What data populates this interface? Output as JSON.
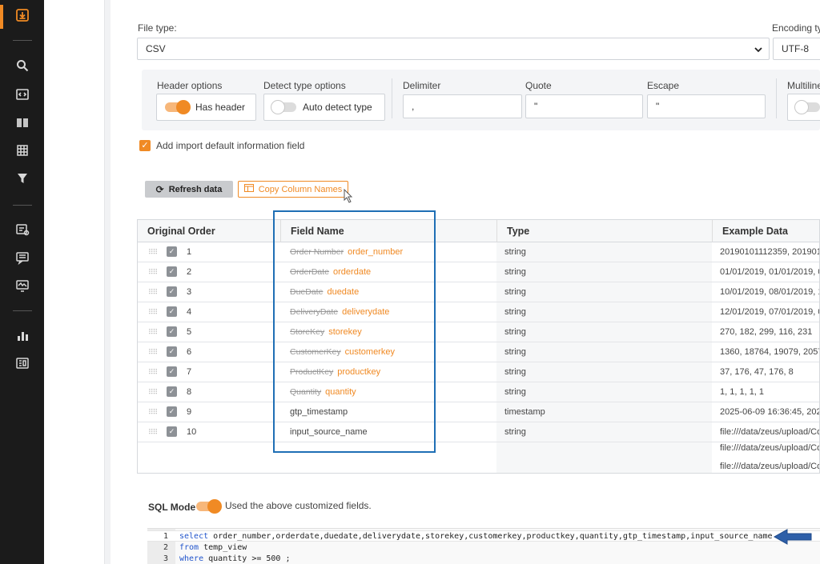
{
  "colors": {
    "accent": "#f08a24",
    "highlight": "#1f6fb5",
    "nav_bg": "#1b1b1b"
  },
  "nav": {
    "icons": [
      "import-icon",
      "search-icon",
      "code-icon",
      "book-icon",
      "table-icon",
      "funnel-icon",
      "workflow-icon",
      "message-icon",
      "monitor-icon",
      "bar-chart-icon",
      "report-icon"
    ]
  },
  "form": {
    "file_type_label": "File type:",
    "file_type_value": "CSV",
    "encoding_label": "Encoding ty",
    "encoding_value": "UTF-8"
  },
  "options": {
    "header_label": "Header options",
    "header_toggle": "Has header",
    "detect_label": "Detect type options",
    "detect_toggle": "Auto detect type",
    "delimiter_label": "Delimiter",
    "delimiter_value": ",",
    "quote_label": "Quote",
    "quote_value": "\"",
    "escape_label": "Escape",
    "escape_value": "\"",
    "multiline_label": "Multiline"
  },
  "import_default_label": "Add import default information field",
  "buttons": {
    "refresh": "Refresh data",
    "copy_columns": "Copy Column Names"
  },
  "table": {
    "headers": [
      "Original Order",
      "Field Name",
      "Type",
      "Example Data"
    ],
    "rows": [
      {
        "n": "1",
        "old": "Order Number",
        "name": "order_number",
        "type": "string",
        "example": "20190101112359, 201901"
      },
      {
        "n": "2",
        "old": "OrderDate",
        "name": "orderdate",
        "type": "string",
        "example": "01/01/2019, 01/01/2019, 0"
      },
      {
        "n": "3",
        "old": "DueDate",
        "name": "duedate",
        "type": "string",
        "example": "10/01/2019, 08/01/2019, 1"
      },
      {
        "n": "4",
        "old": "DeliveryDate",
        "name": "deliverydate",
        "type": "string",
        "example": "12/01/2019, 07/01/2019, 0"
      },
      {
        "n": "5",
        "old": "StoreKey",
        "name": "storekey",
        "type": "string",
        "example": "270, 182, 299, 116, 231"
      },
      {
        "n": "6",
        "old": "CustomerKey",
        "name": "customerkey",
        "type": "string",
        "example": "1360, 18764, 19079, 2057,"
      },
      {
        "n": "7",
        "old": "ProductKey",
        "name": "productkey",
        "type": "string",
        "example": "37, 176, 47, 176, 8"
      },
      {
        "n": "8",
        "old": "Quantity",
        "name": "quantity",
        "type": "string",
        "example": "1, 1, 1, 1, 1"
      },
      {
        "n": "9",
        "old": "",
        "name": "gtp_timestamp",
        "type": "timestamp",
        "example": "2025-06-09 16:36:45, 2025-"
      },
      {
        "n": "10",
        "old": "",
        "name": "input_source_name",
        "type": "string",
        "example": "file:///data/zeus/upload/Co"
      }
    ],
    "extra_examples": [
      "file:///data/zeus/upload/Co",
      "file:///data/zeus/upload/Co"
    ]
  },
  "sql": {
    "label": "SQL Mode",
    "hint": "Used the above customized fields.",
    "lines": [
      {
        "n": "1",
        "kw": "select",
        "rest": " order_number,orderdate,duedate,deliverydate,storekey,customerkey,productkey,quantity,gtp_timestamp,input_source_name"
      },
      {
        "n": "2",
        "kw": "from",
        "rest": " temp_view"
      },
      {
        "n": "3",
        "kw": "where",
        "rest": " quantity >= 500 ;"
      }
    ]
  }
}
